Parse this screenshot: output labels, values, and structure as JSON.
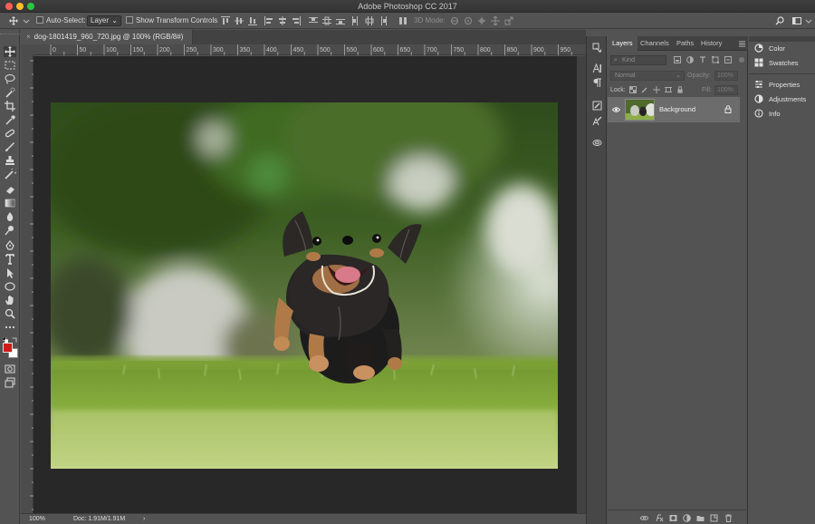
{
  "window": {
    "title": "Adobe Photoshop CC 2017"
  },
  "options_bar": {
    "auto_select_label": "Auto-Select:",
    "auto_select_value": "Layer",
    "show_transform_label": "Show Transform Controls",
    "mode_3d_label": "3D Mode:"
  },
  "document": {
    "tab_title": "dog-1801419_960_720.jpg @ 100% (RGB/8#)",
    "close_glyph": "×"
  },
  "ruler": {
    "h_labels": [
      "0",
      "50",
      "100",
      "150",
      "200",
      "250",
      "300",
      "350",
      "400",
      "450",
      "500",
      "550",
      "600",
      "650",
      "700",
      "750",
      "800",
      "850",
      "900",
      "950"
    ]
  },
  "status": {
    "zoom": "100%",
    "doc_size": "Doc: 1.91M/1.91M",
    "arrow": "›"
  },
  "layers_panel": {
    "tabs": [
      "Layers",
      "Channels",
      "Paths",
      "History"
    ],
    "active_tab": "Layers",
    "kind_placeholder": "Kind",
    "blend_mode": "Normal",
    "opacity_label": "Opacity:",
    "opacity_value": "100%",
    "lock_label": "Lock:",
    "fill_label": "Fill:",
    "fill_value": "100%",
    "layers": [
      {
        "name": "Background",
        "visible": true,
        "locked": true
      }
    ]
  },
  "right_panel": {
    "group1": [
      "Color",
      "Swatches"
    ],
    "group2": [
      "Properties",
      "Adjustments",
      "Info"
    ]
  },
  "colors": {
    "foreground": "#cc1b1b",
    "background": "#ffffff"
  }
}
